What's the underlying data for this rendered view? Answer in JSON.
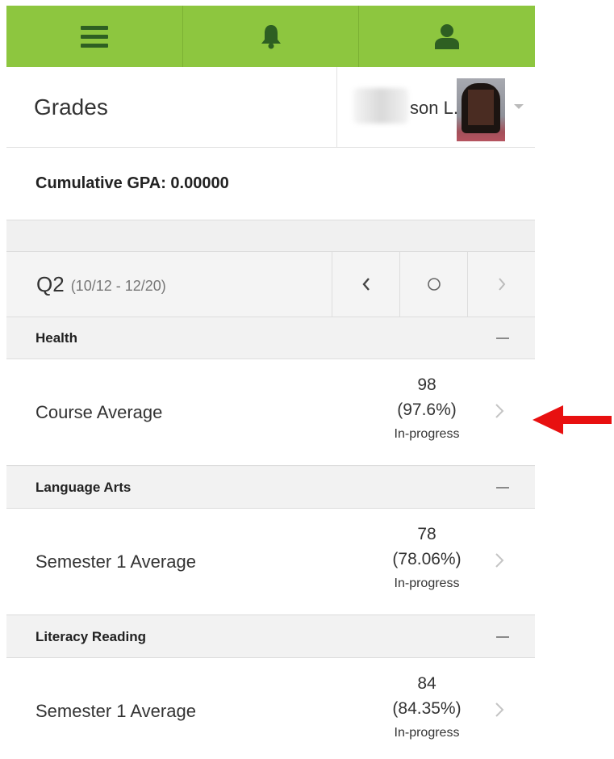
{
  "nav": {
    "items": [
      {
        "name": "menu-icon"
      },
      {
        "name": "bell-icon"
      },
      {
        "name": "user-icon"
      }
    ],
    "bar_color": "#8dc63f",
    "icon_color": "#2e5f22"
  },
  "header": {
    "title": "Grades",
    "user_name": "son L."
  },
  "gpa": {
    "text": "Cumulative GPA: 0.00000"
  },
  "term": {
    "name": "Q2",
    "dates": "(10/12 - 12/20)"
  },
  "sections": [
    {
      "name": "Health",
      "row": {
        "label": "Course Average",
        "score": "98",
        "percent": "(97.6%)",
        "status": "In-progress"
      }
    },
    {
      "name": "Language Arts",
      "row": {
        "label": "Semester 1 Average",
        "score": "78",
        "percent": "(78.06%)",
        "status": "In-progress"
      }
    },
    {
      "name": "Literacy Reading",
      "row": {
        "label": "Semester 1 Average",
        "score": "84",
        "percent": "(84.35%)",
        "status": "In-progress"
      }
    }
  ],
  "annotation": {
    "arrow_color": "#e81010"
  }
}
